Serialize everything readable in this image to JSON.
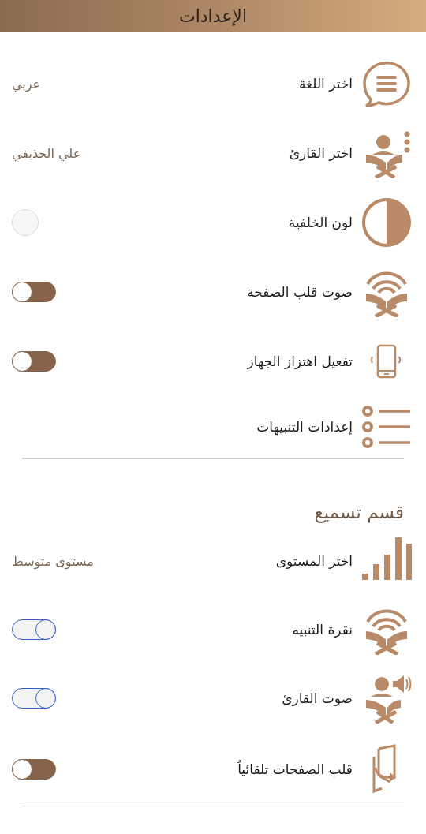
{
  "header": {
    "title": "الإعدادات"
  },
  "sections": [
    {
      "items": [
        {
          "kind": "value",
          "label": "اختر اللغة",
          "value": "عربي"
        },
        {
          "kind": "value",
          "label": "اختر القارئ",
          "value": "علي الحذيفي"
        },
        {
          "kind": "color",
          "label": "لون الخلفية",
          "color": "#f7f7f7"
        },
        {
          "kind": "toggle",
          "label": "صوت قلب الصفحة",
          "on": false
        },
        {
          "kind": "toggle",
          "label": "تفعيل اهتزاز الجهاز",
          "on": false
        },
        {
          "kind": "link",
          "label": "إعدادات التنبيهات"
        }
      ]
    },
    {
      "heading": "قسم تسميع",
      "items": [
        {
          "kind": "value",
          "label": "اختر المستوى",
          "value": "مستوى متوسط"
        },
        {
          "kind": "toggle",
          "label": "نقرة التنبيه",
          "on": true
        },
        {
          "kind": "toggle",
          "label": "صوت القارئ",
          "on": true
        },
        {
          "kind": "toggle",
          "label": "قلب الصفحات تلقائياً",
          "on": false
        }
      ]
    }
  ]
}
